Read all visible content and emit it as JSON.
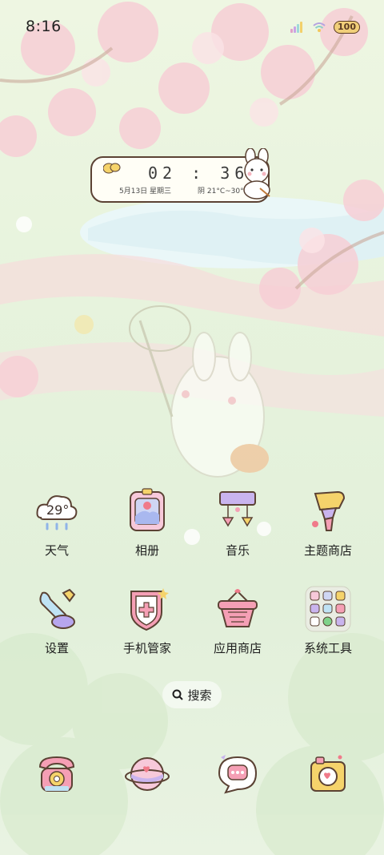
{
  "status_bar": {
    "time": "8:16",
    "battery": "100"
  },
  "clock_widget": {
    "time": "02 : 36",
    "date": "5月13日 星期三",
    "weather": "阴 21°C~30°C"
  },
  "apps": [
    {
      "label": "天气",
      "icon": "weather-icon",
      "temp": "29°"
    },
    {
      "label": "相册",
      "icon": "gallery-icon"
    },
    {
      "label": "音乐",
      "icon": "music-icon"
    },
    {
      "label": "主题商店",
      "icon": "theme-store-icon"
    },
    {
      "label": "设置",
      "icon": "settings-icon"
    },
    {
      "label": "手机管家",
      "icon": "phone-manager-icon"
    },
    {
      "label": "应用商店",
      "icon": "app-store-icon"
    },
    {
      "label": "系统工具",
      "icon": "system-tools-folder-icon"
    }
  ],
  "search": {
    "label": "搜索",
    "icon": "search-icon"
  },
  "dock": [
    {
      "icon": "phone-icon"
    },
    {
      "icon": "browser-icon"
    },
    {
      "icon": "messages-icon"
    },
    {
      "icon": "camera-icon"
    }
  ],
  "colors": {
    "background": "#e7f3dd",
    "blossom": "#f7c9cf",
    "outline": "#5b4234"
  }
}
